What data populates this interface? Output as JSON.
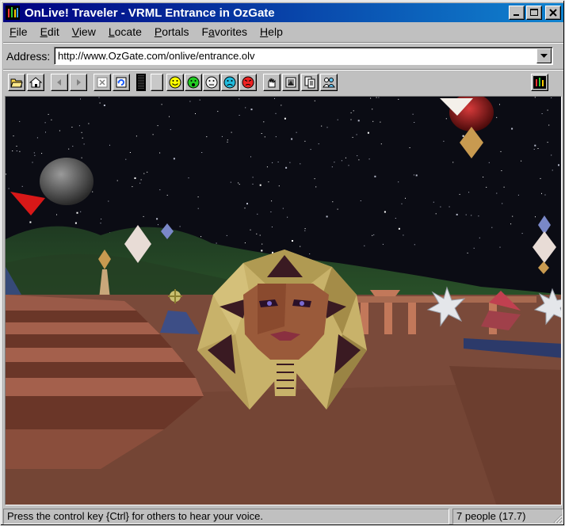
{
  "window": {
    "title": "OnLive! Traveler - VRML Entrance in OzGate",
    "icon": "onlive-traveler-icon",
    "controls": {
      "minimize": "minimize-icon",
      "maximize": "maximize-icon",
      "close": "close-icon"
    }
  },
  "menu": [
    {
      "name": "menu-file",
      "label": "File",
      "underline": "F",
      "rest": "ile"
    },
    {
      "name": "menu-edit",
      "label": "Edit",
      "underline": "E",
      "rest": "dit"
    },
    {
      "name": "menu-view",
      "label": "View",
      "underline": "V",
      "rest": "iew"
    },
    {
      "name": "menu-locate",
      "label": "Locate",
      "underline": "L",
      "rest": "ocate"
    },
    {
      "name": "menu-portals",
      "label": "Portals",
      "underline": "P",
      "rest": "ortals"
    },
    {
      "name": "menu-favorites",
      "label": "Favorites",
      "pre": "F",
      "underline": "a",
      "rest": "vorites"
    },
    {
      "name": "menu-help",
      "label": "Help",
      "underline": "H",
      "rest": "elp"
    }
  ],
  "address": {
    "label": "Address:",
    "value": "http://www.OzGate.com/onlive/entrance.olv"
  },
  "toolbar": {
    "buttons": [
      "open-folder-icon",
      "home-icon",
      "back-arrow-icon",
      "forward-arrow-icon",
      "stop-icon",
      "refresh-icon",
      "volume-meter-icon",
      "blank-slot-icon",
      "happy-face-icon",
      "surprised-face-icon",
      "neutral-face-icon",
      "sad-face-icon",
      "angry-face-icon",
      "gesture-icon",
      "map-icon",
      "portal-icon",
      "people-icon",
      "onlive-logo-icon"
    ]
  },
  "status": {
    "message": "Press the control key {Ctrl} for others to hear your voice.",
    "people": "7 people (17.7)"
  },
  "colors": {
    "titlebar_start": "#000080",
    "titlebar_end": "#1084d0",
    "sky": "#0b0c14",
    "ground": "#7a4a3a"
  }
}
